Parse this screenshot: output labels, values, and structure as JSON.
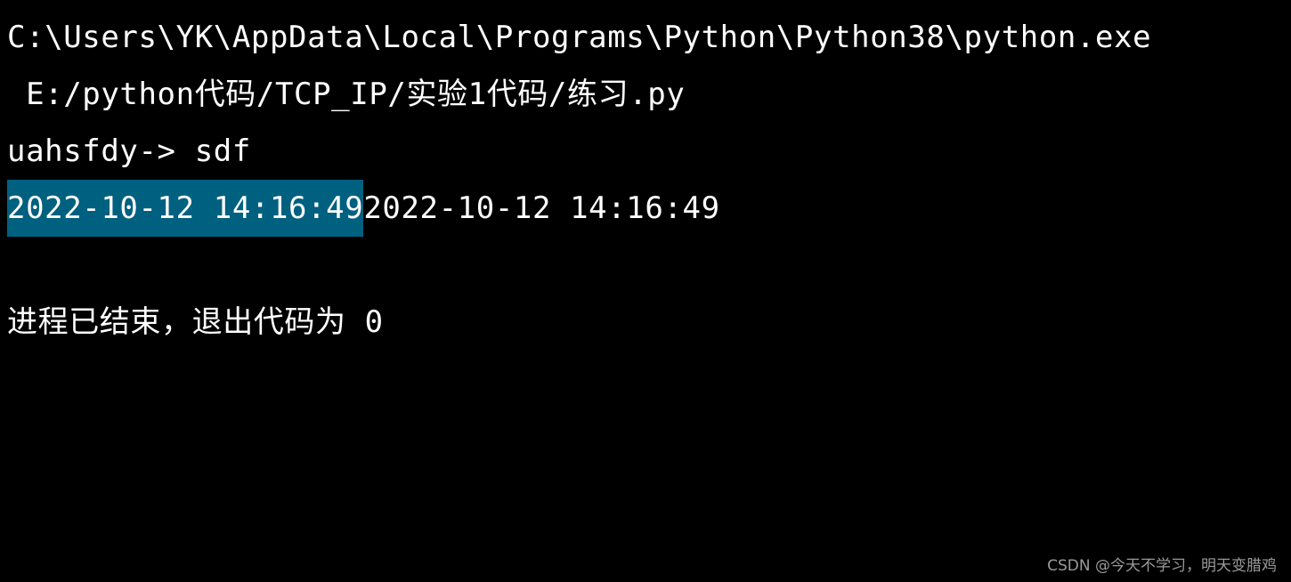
{
  "console": {
    "command_line_1": "C:\\Users\\YK\\AppData\\Local\\Programs\\Python\\Python38\\python.exe",
    "command_line_2": " E:/python代码/TCP_IP/实验1代码/练习.py",
    "prompt_line": "uahsfdy-> sdf",
    "output_selected": "2022-10-12 14:16:49",
    "output_rest": "2022-10-12 14:16:49",
    "exit_message": "进程已结束，退出代码为 0"
  },
  "watermark": "CSDN @今天不学习，明天变腊鸡",
  "colors": {
    "background": "#000000",
    "text": "#ffffff",
    "selection": "#00607f",
    "watermark": "#9a9a9a"
  }
}
